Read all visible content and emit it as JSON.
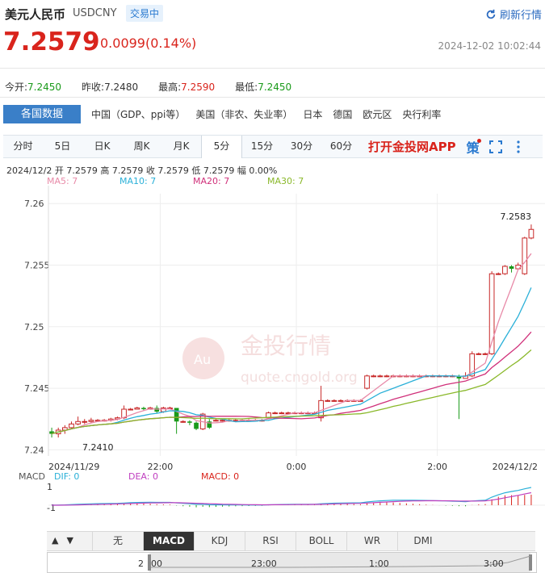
{
  "header": {
    "name": "美元人民币",
    "code": "USDCNY",
    "badge": "交易中",
    "refresh": "刷新行情",
    "price": "7.2579",
    "change": "0.0099(0.14%)",
    "timestamp": "2024-12-02 10:02:44"
  },
  "stats": [
    {
      "label": "今开:",
      "value": "7.2450",
      "color": "green"
    },
    {
      "label": "昨收:",
      "value": "7.2480",
      "color": "plain"
    },
    {
      "label": "最高:",
      "value": "7.2590",
      "color": "red"
    },
    {
      "label": "最低:",
      "value": "7.2450",
      "color": "green"
    }
  ],
  "nav": {
    "active": "各国数据",
    "items": [
      "中国（GDP、ppi等）",
      "美国（非农、失业率）",
      "日本",
      "德国",
      "欧元区",
      "央行利率"
    ]
  },
  "tabs": {
    "items": [
      "分时",
      "5日",
      "日K",
      "周K",
      "月K",
      "5分",
      "15分",
      "30分",
      "60分"
    ],
    "active_index": 5,
    "app_link": "打开金投网APP"
  },
  "info": {
    "date": "2024/12/2",
    "open_label": "开",
    "open": "7.2579",
    "high_label": "高",
    "high": "7.2579",
    "close_label": "收",
    "close": "7.2579",
    "low_label": "低",
    "low": "7.2579",
    "amp_label": "幅",
    "amp": "0.00%"
  },
  "ma_labels": {
    "ma5": "MA5: 7",
    "ma10": "MA10: 7",
    "ma20": "MA20: 7",
    "ma30": "MA30: 7"
  },
  "watermark": {
    "brand": "金投行情",
    "url": "quote.cngold.org",
    "logo": "Au"
  },
  "chart_data": {
    "type": "candlestick",
    "y_ticks": [
      "7.26",
      "7.255",
      "7.25",
      "7.245",
      "7.24"
    ],
    "ylim": [
      7.2395,
      7.2608
    ],
    "x_ticks": [
      "2024/11/29",
      "22:00",
      "0:00",
      "2:00",
      "2024/12/2"
    ],
    "x_tick_pos": [
      0.0,
      0.23,
      0.51,
      0.8,
      1.0
    ],
    "annotations": {
      "high": "7.2583",
      "low": "7.2410"
    },
    "candles": [
      [
        7.2415,
        7.2413,
        7.2418,
        7.241
      ],
      [
        7.2413,
        7.2416,
        7.2418,
        7.241
      ],
      [
        7.2416,
        7.2418,
        7.242,
        7.2413
      ],
      [
        7.2418,
        7.2421,
        7.2423,
        7.2417
      ],
      [
        7.2421,
        7.2423,
        7.2427,
        7.242
      ],
      [
        7.2423,
        7.2423,
        7.2425,
        7.2421
      ],
      [
        7.2423,
        7.2424,
        7.2426,
        7.2422
      ],
      [
        7.2424,
        7.2424,
        7.2425,
        7.2423
      ],
      [
        7.2424,
        7.2424,
        7.2425,
        7.2423
      ],
      [
        7.2424,
        7.2425,
        7.2426,
        7.2423
      ],
      [
        7.2425,
        7.2426,
        7.2427,
        7.2424
      ],
      [
        7.2426,
        7.2433,
        7.2436,
        7.2425
      ],
      [
        7.2433,
        7.2433,
        7.2434,
        7.2432
      ],
      [
        7.2433,
        7.2434,
        7.2435,
        7.2433
      ],
      [
        7.2434,
        7.2433,
        7.2435,
        7.2432
      ],
      [
        7.2433,
        7.2434,
        7.2435,
        7.2433
      ],
      [
        7.2434,
        7.2431,
        7.2436,
        7.243
      ],
      [
        7.2431,
        7.2434,
        7.2435,
        7.243
      ],
      [
        7.2434,
        7.2434,
        7.2435,
        7.2433
      ],
      [
        7.2434,
        7.2423,
        7.2434,
        7.2413
      ],
      [
        7.2423,
        7.2423,
        7.2424,
        7.2422
      ],
      [
        7.2423,
        7.2422,
        7.2424,
        7.242
      ],
      [
        7.2422,
        7.2417,
        7.2423,
        7.2416
      ],
      [
        7.2417,
        7.2429,
        7.243,
        7.2416
      ],
      [
        7.2423,
        7.2418,
        7.2425,
        7.2417
      ],
      [
        7.2424,
        7.2424,
        7.2425,
        7.2423
      ],
      [
        7.2424,
        7.2424,
        7.2425,
        7.2423
      ],
      [
        7.2424,
        7.2424,
        7.2425,
        7.2423
      ],
      [
        7.2424,
        7.2424,
        7.2425,
        7.2423
      ],
      [
        7.2424,
        7.2424,
        7.2425,
        7.2423
      ],
      [
        7.2424,
        7.2424,
        7.2425,
        7.2423
      ],
      [
        7.2424,
        7.2424,
        7.2425,
        7.2423
      ],
      [
        7.2424,
        7.2424,
        7.2425,
        7.2423
      ],
      [
        7.2426,
        7.243,
        7.2431,
        7.2425
      ],
      [
        7.243,
        7.243,
        7.2431,
        7.2429
      ],
      [
        7.243,
        7.243,
        7.2431,
        7.2429
      ],
      [
        7.243,
        7.243,
        7.2431,
        7.2429
      ],
      [
        7.243,
        7.243,
        7.2431,
        7.2429
      ],
      [
        7.243,
        7.243,
        7.2431,
        7.2429
      ],
      [
        7.243,
        7.243,
        7.2431,
        7.2429
      ],
      [
        7.243,
        7.243,
        7.2431,
        7.2429
      ],
      [
        7.2426,
        7.244,
        7.2452,
        7.2423
      ],
      [
        7.244,
        7.244,
        7.2441,
        7.2439
      ],
      [
        7.244,
        7.244,
        7.2441,
        7.2439
      ],
      [
        7.244,
        7.244,
        7.2441,
        7.2439
      ],
      [
        7.244,
        7.244,
        7.2441,
        7.2439
      ],
      [
        7.244,
        7.244,
        7.2441,
        7.2439
      ],
      [
        7.244,
        7.244,
        7.2441,
        7.2439
      ],
      [
        7.245,
        7.246,
        7.2461,
        7.2449
      ],
      [
        7.246,
        7.246,
        7.2461,
        7.2459
      ],
      [
        7.246,
        7.246,
        7.2461,
        7.2459
      ],
      [
        7.246,
        7.246,
        7.2461,
        7.2459
      ],
      [
        7.246,
        7.246,
        7.2461,
        7.2459
      ],
      [
        7.246,
        7.246,
        7.2461,
        7.2459
      ],
      [
        7.246,
        7.246,
        7.2461,
        7.2459
      ],
      [
        7.246,
        7.246,
        7.2461,
        7.2459
      ],
      [
        7.246,
        7.246,
        7.2461,
        7.2459
      ],
      [
        7.246,
        7.246,
        7.2461,
        7.2459
      ],
      [
        7.246,
        7.246,
        7.2461,
        7.2459
      ],
      [
        7.246,
        7.246,
        7.2461,
        7.2459
      ],
      [
        7.246,
        7.246,
        7.2461,
        7.2459
      ],
      [
        7.246,
        7.246,
        7.2461,
        7.2459
      ],
      [
        7.246,
        7.2458,
        7.2461,
        7.2425
      ],
      [
        7.2458,
        7.246,
        7.2463,
        7.2458
      ],
      [
        7.246,
        7.2478,
        7.248,
        7.2459
      ],
      [
        7.2478,
        7.2478,
        7.2479,
        7.2477
      ],
      [
        7.2478,
        7.2478,
        7.2479,
        7.2477
      ],
      [
        7.2478,
        7.2543,
        7.2545,
        7.2477
      ],
      [
        7.2543,
        7.2543,
        7.2544,
        7.2542
      ],
      [
        7.2543,
        7.2549,
        7.255,
        7.2542
      ],
      [
        7.2549,
        7.2547,
        7.255,
        7.2544
      ],
      [
        7.2547,
        7.255,
        7.2552,
        7.2546
      ],
      [
        7.2543,
        7.2572,
        7.2573,
        7.2542
      ],
      [
        7.2572,
        7.2579,
        7.2583,
        7.2571
      ]
    ],
    "macd": {
      "labels": [
        "MACD",
        "DIF: 0",
        "DEA: 0",
        "MACD: 0"
      ],
      "ticks": [
        "1",
        "-1"
      ]
    }
  },
  "indicators": {
    "items": [
      "无",
      "MACD",
      "KDJ",
      "RSI",
      "BOLL",
      "WR",
      "DMI"
    ],
    "active_index": 1
  },
  "navigator": {
    "labels": [
      "2",
      "00",
      "23:00",
      "1:00",
      "3:00"
    ]
  }
}
